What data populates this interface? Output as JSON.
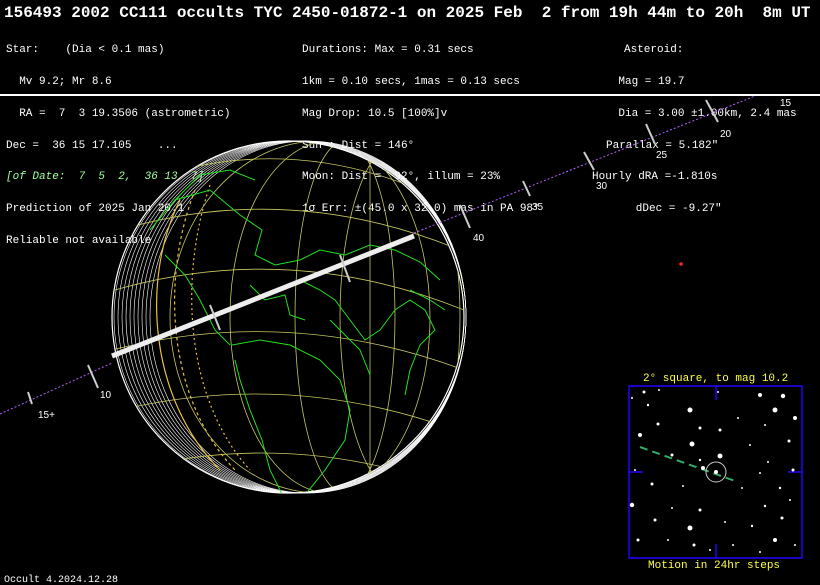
{
  "title": "156493 2002 CC111 occults TYC 2450-01872-1 on 2025 Feb  2 from 19h 44m to 20h  8m UT",
  "star": {
    "lines": [
      "Star:    (Dia < 0.1 mas)",
      "  Mv 9.2; Mr 8.6",
      "  RA =  7  3 19.3506 (astrometric)",
      "Dec =  36 15 17.105    ...",
      "Prediction of 2025 Jan 20.1",
      "Reliable not available"
    ],
    "of_date": "[of Date:  7  5  2,  36 13  7]"
  },
  "durations": {
    "lines": [
      "Durations: Max = 0.31 secs",
      "1km = 0.10 secs, 1mas = 0.13 secs",
      "Mag Drop: 10.5 [100%]v",
      "Sun : Dist = 146°",
      "Moon: Dist =  92°, illum = 23%",
      "1σ Err: ±(45.0 x 32.0) mas in PA 98°"
    ]
  },
  "asteroid": {
    "lines": [
      "Asteroid:",
      "    Mag = 19.7",
      "    Dia = 3.00 ±1.00km, 2.4 mas",
      "Parallax = 5.182\"",
      "Hourly dRA =-1.810s",
      "   dDec = -9.27\""
    ]
  },
  "track_labels": [
    "15",
    "20",
    "25",
    "30",
    "35",
    "40",
    "10",
    "15+"
  ],
  "inset": {
    "title": "2° square, to mag 10.2",
    "caption": "Motion in 24hr steps"
  },
  "footer": "Occult 4.2024.12.28"
}
